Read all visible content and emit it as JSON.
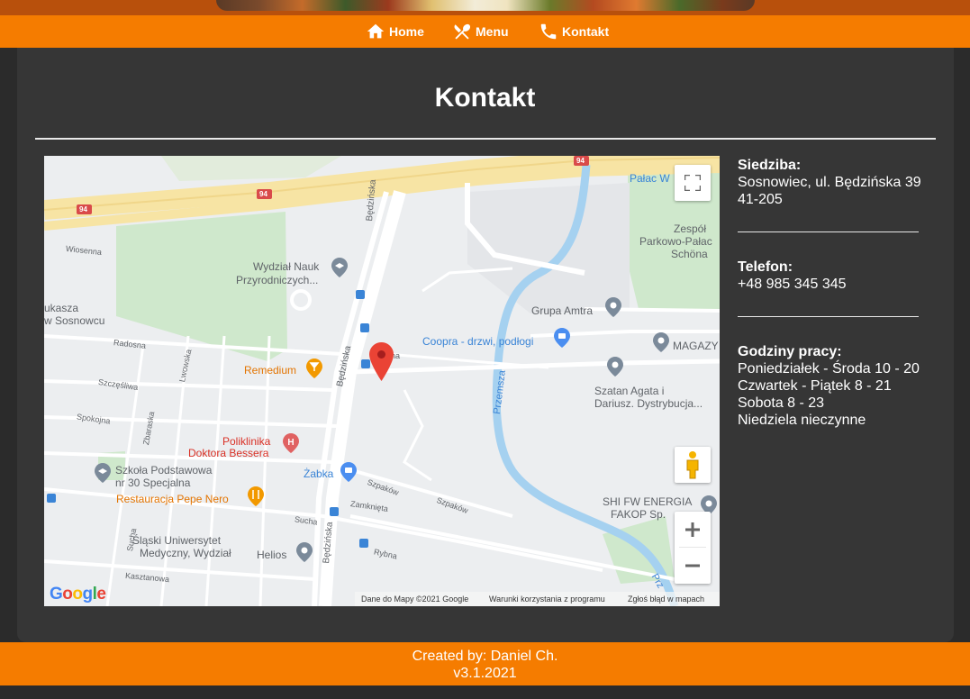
{
  "nav": {
    "items": [
      {
        "label": "Home",
        "icon": "home-icon"
      },
      {
        "label": "Menu",
        "icon": "fork-knife-icon"
      },
      {
        "label": "Kontakt",
        "icon": "phone-icon"
      }
    ]
  },
  "page": {
    "title": "Kontakt"
  },
  "map": {
    "road_number": "94",
    "labels": {
      "wydzial_nauk_1": "Wydział Nauk",
      "wydzial_nauk_2": "Przyrodniczych...",
      "palac": "Pałac W",
      "zespol_1": "Zespół",
      "zespol_2": "Parkowo-Pałac",
      "zespol_3": "Schöna",
      "grupa_amtra": "Grupa Amtra",
      "coopra": "Coopra - drzwi, podłogi",
      "magazyn": "MAGAZY",
      "szatan_1": "Szatan Agata i",
      "szatan_2": "Dariusz. Dystrybucja...",
      "remedium": "Remedium",
      "poliklinika_1": "Poliklinika",
      "poliklinika_2": "Doktora Bessera",
      "zabka": "Żabka",
      "szkola_1": "Szkoła Podstawowa",
      "szkola_2": "nr 30 Specjalna",
      "pepe_nero": "Restauracja Pepe Nero",
      "slaski_1": "Śląski Uniwersytet",
      "slaski_2": "Medyczny, Wydział",
      "helios": "Helios",
      "shi_1": "SHI FW ENERGIA",
      "shi_2": "FAKOP Sp.",
      "lukasza_1": "ukasza",
      "lukasza_2": "w Sosnowcu",
      "bedzinska": "Będzińska",
      "przemsza": "Przemsza",
      "prz": "Prz",
      "wiosenna": "Wiosenna",
      "radosna": "Radosna",
      "szczesliwa": "Szczęśliwa",
      "spokojna": "Spokojna",
      "lwowska": "Lwowska",
      "zbaraska": "Zbaraska",
      "szpakow": "Szpaków",
      "zamknieta": "Zamknięta",
      "sucha": "Sucha",
      "rybna": "Rybna",
      "kasztanowa": "Kasztanowa",
      "na": "na"
    },
    "attribution": "Dane do Mapy ©2021 Google",
    "terms": "Warunki korzystania z programu",
    "report": "Zgłoś błąd w mapach",
    "google": [
      "G",
      "o",
      "o",
      "g",
      "l",
      "e"
    ]
  },
  "info": {
    "siedziba_label": "Siedziba:",
    "siedziba_address": "Sosnowiec, ul. Będzińska 39",
    "siedziba_postal": "41-205",
    "telefon_label": "Telefon:",
    "telefon_value": "+48 985 345 345",
    "hours_label": "Godziny pracy:",
    "hours": [
      "Poniedziałek - Środa 10 - 20",
      "Czwartek - Piątek 8 - 21",
      "Sobota 8 - 23",
      "Niedziela nieczynne"
    ]
  },
  "footer": {
    "created_by": "Created by: Daniel Ch.",
    "version": "v3.1.2021"
  },
  "colors": {
    "accent": "#f57c00",
    "background": "#2b2b2b",
    "card": "#363636",
    "map_marker": "#ea4335"
  }
}
